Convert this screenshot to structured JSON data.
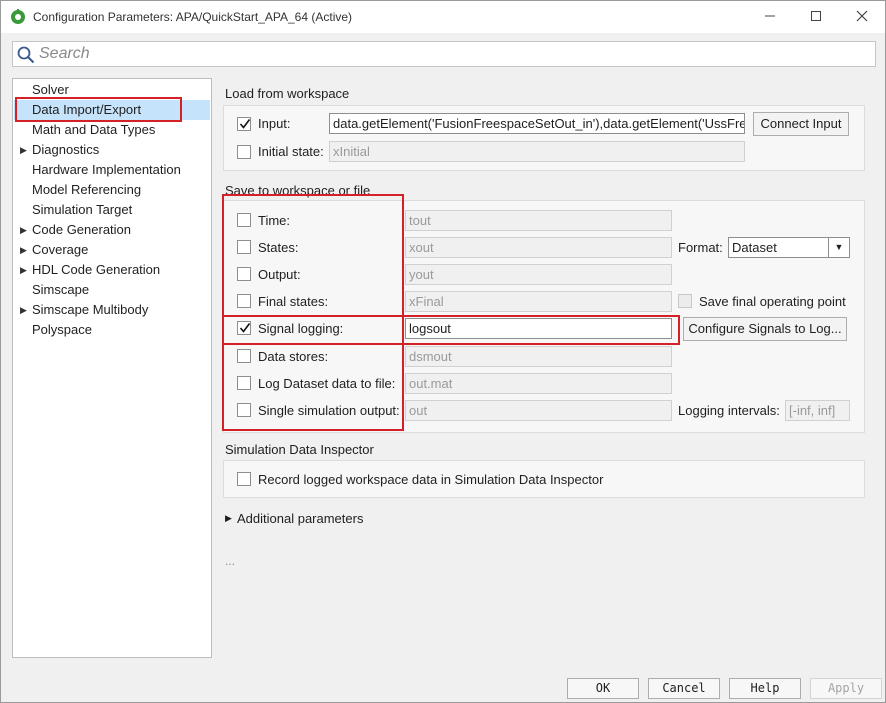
{
  "window": {
    "title": "Configuration Parameters: APA/QuickStart_APA_64 (Active)"
  },
  "search": {
    "placeholder": "Search",
    "value": ""
  },
  "nav": {
    "items": [
      {
        "label": "Solver",
        "expandable": false
      },
      {
        "label": "Data Import/Export",
        "expandable": false,
        "selected": true
      },
      {
        "label": "Math and Data Types",
        "expandable": false
      },
      {
        "label": "Diagnostics",
        "expandable": true
      },
      {
        "label": "Hardware Implementation",
        "expandable": false
      },
      {
        "label": "Model Referencing",
        "expandable": false
      },
      {
        "label": "Simulation Target",
        "expandable": false
      },
      {
        "label": "Code Generation",
        "expandable": true
      },
      {
        "label": "Coverage",
        "expandable": false
      },
      {
        "label": "HDL Code Generation",
        "expandable": true
      },
      {
        "label": "Simscape",
        "expandable": false
      },
      {
        "label": "Simscape Multibody",
        "expandable": true
      },
      {
        "label": "Polyspace",
        "expandable": false
      }
    ]
  },
  "load": {
    "title": "Load from workspace",
    "input_label": "Input:",
    "input_checked": true,
    "input_value": "data.getElement('FusionFreespaceSetOut_in'),data.getElement('UssFre",
    "connect_button": "Connect Input",
    "initial_state_label": "Initial state:",
    "initial_state_checked": false,
    "initial_state_value": "xInitial"
  },
  "save": {
    "title": "Save to workspace or file",
    "rows": [
      {
        "label": "Time:",
        "checked": false,
        "value": "tout"
      },
      {
        "label": "States:",
        "checked": false,
        "value": "xout"
      },
      {
        "label": "Output:",
        "checked": false,
        "value": "yout"
      },
      {
        "label": "Final states:",
        "checked": false,
        "value": "xFinal"
      },
      {
        "label": "Signal logging:",
        "checked": true,
        "value": "logsout"
      },
      {
        "label": "Data stores:",
        "checked": false,
        "value": "dsmout"
      },
      {
        "label": "Log Dataset data to file:",
        "checked": false,
        "value": "out.mat"
      },
      {
        "label": "Single simulation output:",
        "checked": false,
        "value": "out"
      }
    ],
    "format_label": "Format:",
    "format_value": "Dataset",
    "save_final_op_label": "Save final operating point",
    "configure_button": "Configure Signals to Log...",
    "logging_intervals_label": "Logging intervals:",
    "logging_intervals_value": "[-inf, inf]"
  },
  "sdi": {
    "title": "Simulation Data Inspector",
    "record_label": "Record logged workspace data in Simulation Data Inspector",
    "record_checked": false
  },
  "additional": {
    "label": "Additional parameters"
  },
  "ellipsis": "...",
  "footer": {
    "ok": "OK",
    "cancel": "Cancel",
    "help": "Help",
    "apply": "Apply"
  },
  "colors": {
    "selection": "#c5e4fb",
    "highlight": "#d42027",
    "background": "#f0f0f0"
  }
}
